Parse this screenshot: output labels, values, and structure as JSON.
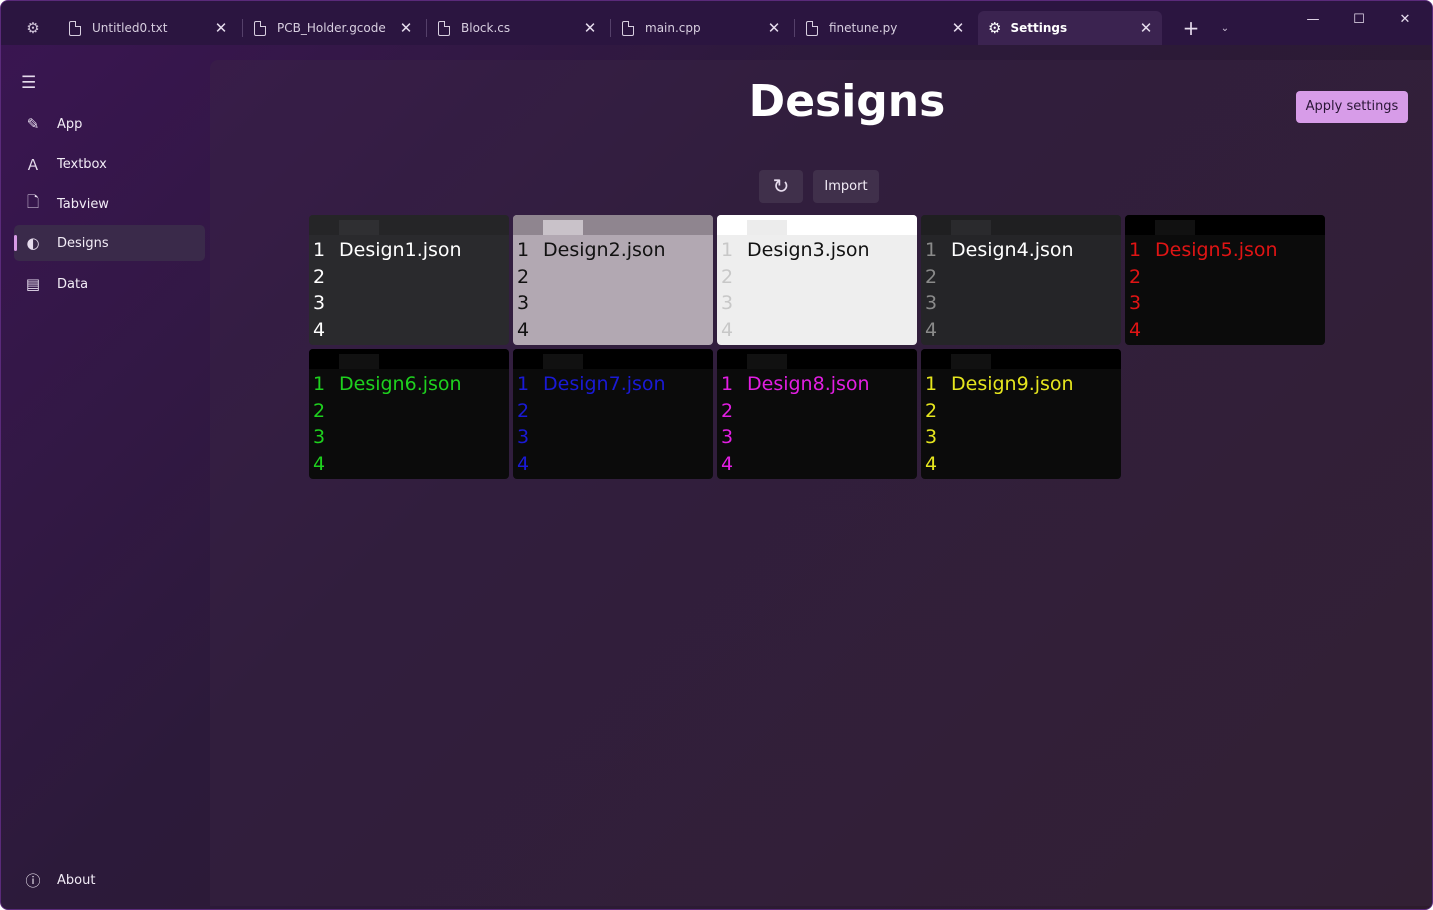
{
  "tabbar": {
    "tabs": [
      {
        "label": "Untitled0.txt"
      },
      {
        "label": "PCB_Holder.gcode"
      },
      {
        "label": "Block.cs"
      },
      {
        "label": "main.cpp"
      },
      {
        "label": "finetune.py"
      },
      {
        "label": "Settings"
      }
    ],
    "close_glyph": "✕",
    "add_glyph": "+",
    "dropdown_glyph": "⌄",
    "window": {
      "minimize": "—",
      "maximize": "☐",
      "close": "✕"
    }
  },
  "sidebar": {
    "items": [
      {
        "label": "App",
        "icon": "pencil-icon",
        "glyph": "✎"
      },
      {
        "label": "Textbox",
        "icon": "font-size-icon",
        "glyph": "Ａ"
      },
      {
        "label": "Tabview",
        "icon": "document-icon",
        "glyph": "🗋"
      },
      {
        "label": "Designs",
        "icon": "palette-icon",
        "glyph": "◐",
        "selected": true
      },
      {
        "label": "Data",
        "icon": "data-icon",
        "glyph": "▤"
      }
    ],
    "about": {
      "label": "About",
      "icon": "info-icon",
      "glyph": "ⓘ"
    }
  },
  "main": {
    "title": "Designs",
    "apply_label": "Apply settings",
    "reset_glyph": "↻",
    "import_label": "Import"
  },
  "designs": [
    {
      "name": "Design1.json",
      "lines": "1\n2\n3\n4",
      "bg": "#2a2a2d",
      "bar": "#252527",
      "tab": "#2f2f32",
      "fg": "#ffffff",
      "num": "#ffffff"
    },
    {
      "name": "Design2.json",
      "lines": "1\n2\n3\n4",
      "bg": "#b2a8b2",
      "bar": "#8f858f",
      "tab": "#c9c2c9",
      "fg": "#111111",
      "num": "#111111"
    },
    {
      "name": "Design3.json",
      "lines": "1\n2\n3\n4",
      "bg": "#eeeeee",
      "bar": "#ffffff",
      "tab": "#ececec",
      "fg": "#111111",
      "num": "#c8c8c8"
    },
    {
      "name": "Design4.json",
      "lines": "1\n2\n3\n4",
      "bg": "#252528",
      "bar": "#1f1f21",
      "tab": "#2a2a2d",
      "fg": "#ffffff",
      "num": "#8a8a8a"
    },
    {
      "name": "Design5.json",
      "lines": "1\n2\n3\n4",
      "bg": "#0b0b0b",
      "bar": "#000000",
      "tab": "#111111",
      "fg": "#e01414",
      "num": "#e01414"
    },
    {
      "name": "Design6.json",
      "lines": "1\n2\n3\n4",
      "bg": "#0b0b0b",
      "bar": "#000000",
      "tab": "#111111",
      "fg": "#1ed11e",
      "num": "#1ed11e"
    },
    {
      "name": "Design7.json",
      "lines": "1\n2\n3\n4",
      "bg": "#0b0b0b",
      "bar": "#000000",
      "tab": "#111111",
      "fg": "#1a1ad6",
      "num": "#1a1ad6"
    },
    {
      "name": "Design8.json",
      "lines": "1\n2\n3\n4",
      "bg": "#0b0b0b",
      "bar": "#000000",
      "tab": "#111111",
      "fg": "#e31ee3",
      "num": "#e31ee3"
    },
    {
      "name": "Design9.json",
      "lines": "1\n2\n3\n4",
      "bg": "#0b0b0b",
      "bar": "#000000",
      "tab": "#111111",
      "fg": "#e6e61e",
      "num": "#e6e61e"
    }
  ],
  "colors": {
    "accent": "#d79ce8",
    "tabbar_bg": "#2b1540"
  }
}
